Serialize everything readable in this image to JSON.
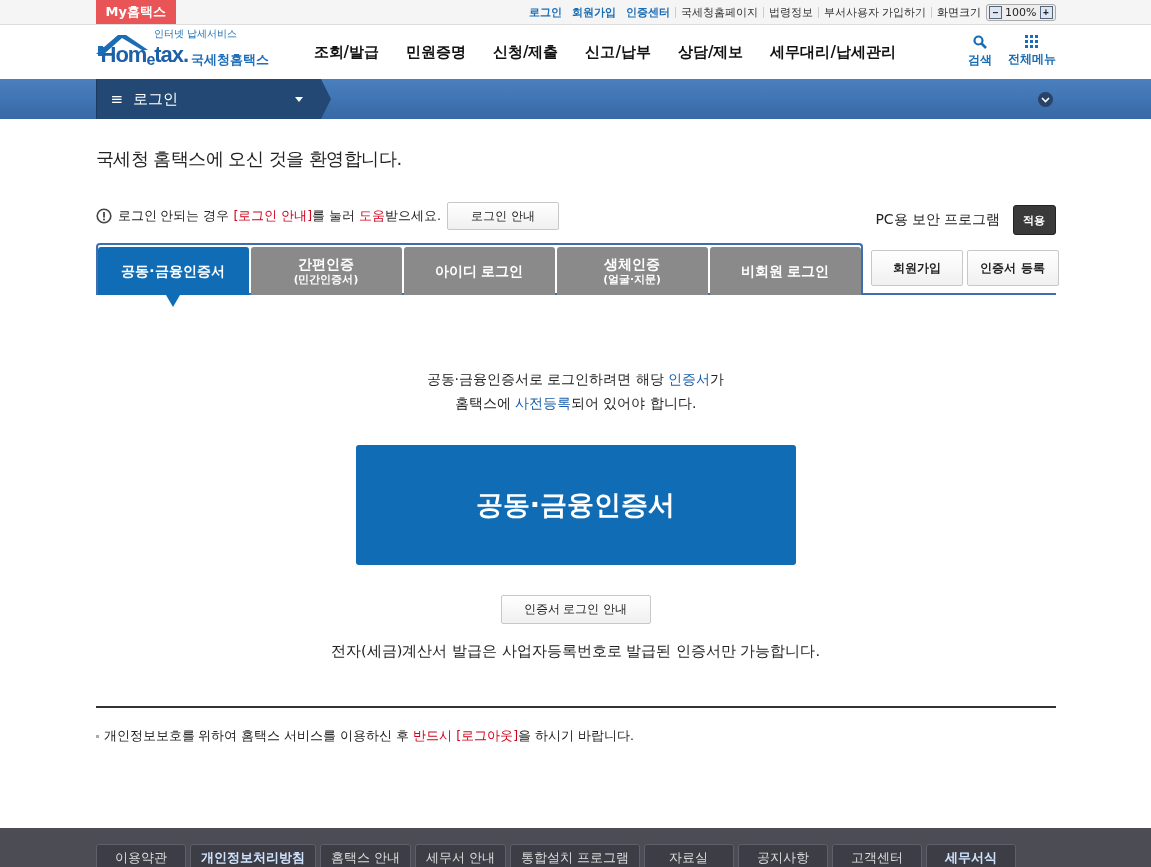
{
  "top_bar": {
    "my_tab": "My홈택스",
    "links": [
      {
        "label": "로그인",
        "strong": true
      },
      {
        "label": "회원가입",
        "strong": true
      },
      {
        "label": "인증센터",
        "strong": true
      },
      {
        "label": "국세청홈페이지",
        "strong": false
      },
      {
        "label": "법령정보",
        "strong": false
      },
      {
        "label": "부서사용자 가입하기",
        "strong": false
      }
    ],
    "zoom_label": "화면크기",
    "zoom_minus": "−",
    "zoom_value": "100%",
    "zoom_plus": "+"
  },
  "logo": {
    "tagline": "인터넷 납세서비스",
    "wordmark": "Hom$_{e}$tax.",
    "name": "국세청홈택스"
  },
  "main_nav": [
    "조회/발급",
    "민원증명",
    "신청/제출",
    "신고/납부",
    "상담/제보",
    "세무대리/납세관리"
  ],
  "header_tools": [
    {
      "kind": "search",
      "label": "검색"
    },
    {
      "kind": "grid",
      "label": "전체메뉴"
    }
  ],
  "breadcrumb": {
    "menu_icon": "≡",
    "label": "로그인"
  },
  "welcome": "국세청 홈택스에 오신 것을 환영합니다.",
  "help_notice": [
    {
      "text": "로그인 안되는 경우 ",
      "highlight": false
    },
    {
      "text": "[로그인 안내]",
      "highlight": true
    },
    {
      "text": "를 눌러 ",
      "highlight": false
    },
    {
      "text": "도움",
      "highlight": true
    },
    {
      "text": "받으세요.",
      "highlight": false
    }
  ],
  "help_button": "로그인 안내",
  "security": {
    "label": "PC용 보안 프로그램",
    "button": "적용"
  },
  "login_tabs": [
    {
      "label": "공동·금융인증서",
      "selected": true
    },
    {
      "label": "간편인증",
      "sub": "(민간인증서)",
      "selected": false
    },
    {
      "label": "아이디 로그인",
      "selected": false
    },
    {
      "label": "생체인증",
      "sub": "(얼굴·지문)",
      "selected": false
    },
    {
      "label": "비회원 로그인",
      "selected": false
    }
  ],
  "side_buttons": [
    "회원가입",
    "인증서 등록"
  ],
  "cert_notice": [
    [
      {
        "text": "공동·금융인증서로 로그인하려면 해당 ",
        "highlight": false
      },
      {
        "text": "인증서",
        "highlight": true
      },
      {
        "text": "가",
        "highlight": false
      }
    ],
    [
      {
        "text": "홈택스에 ",
        "highlight": false
      },
      {
        "text": "사전등록",
        "highlight": true
      },
      {
        "text": "되어 있어야 합니다.",
        "highlight": false
      }
    ]
  ],
  "cert_button": "공동·금융인증서",
  "cert_guide_button": "인증서 로그인 안내",
  "invoice_note": "전자(세금)계산서 발급은 사업자등록번호로 발급된 인증서만 가능합니다.",
  "privacy_notice": [
    {
      "text": "개인정보보호를 위하여 홈택스 서비스를 이용하신 후 ",
      "highlight": false
    },
    {
      "text": "반드시 [로그아웃]",
      "highlight": true
    },
    {
      "text": "을 하시기 바랍니다.",
      "highlight": false
    }
  ],
  "footer_links": [
    {
      "label": "이용약관",
      "emphasized": false
    },
    {
      "label": "개인정보처리방침",
      "emphasized": true
    },
    {
      "label": "홈택스 안내",
      "emphasized": false
    },
    {
      "label": "세무서 안내",
      "emphasized": false
    },
    {
      "label": "통합설치 프로그램",
      "emphasized": false
    },
    {
      "label": "자료실",
      "emphasized": false
    },
    {
      "label": "공지사항",
      "emphasized": false
    },
    {
      "label": "고객센터",
      "emphasized": false
    },
    {
      "label": "세무서식",
      "emphasized": true
    }
  ]
}
